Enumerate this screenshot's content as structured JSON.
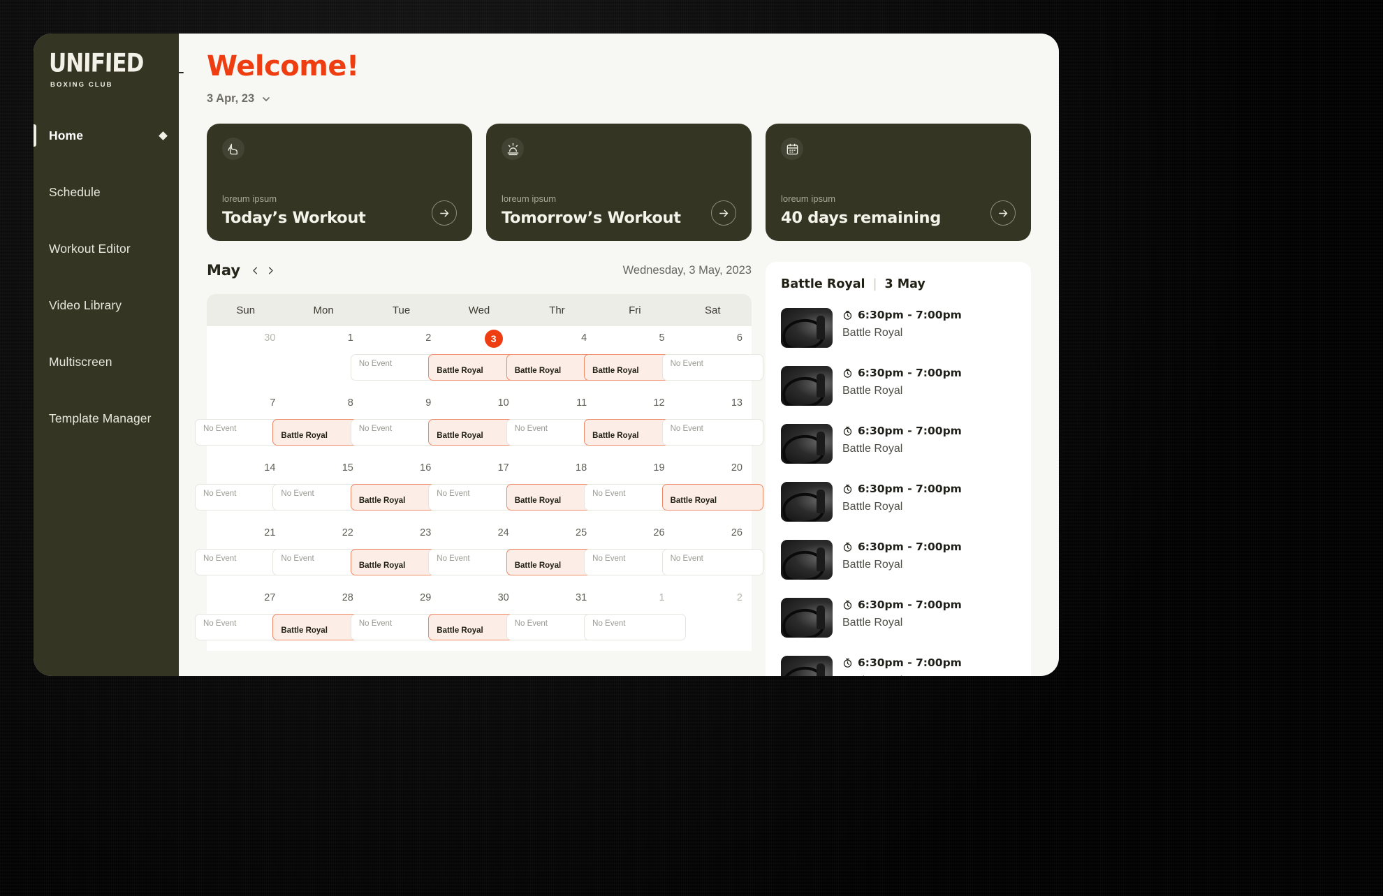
{
  "sidebar": {
    "logo": {
      "main": "UNIFIED",
      "sub": "BOXING CLUB"
    },
    "items": [
      {
        "label": "Home",
        "active": true,
        "icon": "diamond-icon"
      },
      {
        "label": "Schedule",
        "active": false
      },
      {
        "label": "Workout Editor",
        "active": false
      },
      {
        "label": "Video Library",
        "active": false
      },
      {
        "label": "Multiscreen",
        "active": false
      },
      {
        "label": "Template Manager",
        "active": false
      }
    ]
  },
  "header": {
    "back_icon": "arrow-left-icon",
    "title": "Welcome!",
    "date_value": "3 Apr, 23",
    "date_chevron": "chevron-down-icon",
    "title_color": "#EE3E11"
  },
  "cards": [
    {
      "icon": "bicep-icon",
      "subtitle": "loreum ipsum",
      "title": "Today’s Workout",
      "arrow": "arrow-right-icon"
    },
    {
      "icon": "sunrise-icon",
      "subtitle": "loreum ipsum",
      "title": "Tomorrow’s Workout",
      "arrow": "arrow-right-icon"
    },
    {
      "icon": "calendar-icon",
      "subtitle": "loreum ipsum",
      "title": "40 days remaining",
      "arrow": "arrow-right-icon"
    }
  ],
  "calendar": {
    "month": "May",
    "prev_icon": "chevron-left-icon",
    "next_icon": "chevron-right-icon",
    "full_date": "Wednesday, 3 May, 2023",
    "day_headers": [
      "Sun",
      "Mon",
      "Tue",
      "Wed",
      "Thr",
      "Fri",
      "Sat"
    ],
    "event_label": "Battle Royal",
    "empty_label": "No Event",
    "today": 3,
    "weeks": [
      [
        {
          "num": "30",
          "muted": true,
          "pill": null
        },
        {
          "num": "1",
          "muted": false,
          "pill": null
        },
        {
          "num": "2",
          "muted": false,
          "pill": "none"
        },
        {
          "num": "3",
          "muted": false,
          "pill": "event",
          "today": true
        },
        {
          "num": "4",
          "muted": false,
          "pill": "event"
        },
        {
          "num": "5",
          "muted": false,
          "pill": "event"
        },
        {
          "num": "6",
          "muted": false,
          "pill": "none"
        }
      ],
      [
        {
          "num": "7",
          "muted": false,
          "pill": "none"
        },
        {
          "num": "8",
          "muted": false,
          "pill": "event"
        },
        {
          "num": "9",
          "muted": false,
          "pill": "none"
        },
        {
          "num": "10",
          "muted": false,
          "pill": "event"
        },
        {
          "num": "11",
          "muted": false,
          "pill": "none"
        },
        {
          "num": "12",
          "muted": false,
          "pill": "event"
        },
        {
          "num": "13",
          "muted": false,
          "pill": "none"
        }
      ],
      [
        {
          "num": "14",
          "muted": false,
          "pill": "none"
        },
        {
          "num": "15",
          "muted": false,
          "pill": "none"
        },
        {
          "num": "16",
          "muted": false,
          "pill": "event"
        },
        {
          "num": "17",
          "muted": false,
          "pill": "none"
        },
        {
          "num": "18",
          "muted": false,
          "pill": "event"
        },
        {
          "num": "19",
          "muted": false,
          "pill": "none"
        },
        {
          "num": "20",
          "muted": false,
          "pill": "event"
        }
      ],
      [
        {
          "num": "21",
          "muted": false,
          "pill": "none"
        },
        {
          "num": "22",
          "muted": false,
          "pill": "none"
        },
        {
          "num": "23",
          "muted": false,
          "pill": "event"
        },
        {
          "num": "24",
          "muted": false,
          "pill": "none"
        },
        {
          "num": "25",
          "muted": false,
          "pill": "event"
        },
        {
          "num": "26",
          "muted": false,
          "pill": "none"
        },
        {
          "num": "26",
          "muted": false,
          "pill": "none"
        }
      ],
      [
        {
          "num": "27",
          "muted": false,
          "pill": "none"
        },
        {
          "num": "28",
          "muted": false,
          "pill": "event"
        },
        {
          "num": "29",
          "muted": false,
          "pill": "none"
        },
        {
          "num": "30",
          "muted": false,
          "pill": "event"
        },
        {
          "num": "31",
          "muted": false,
          "pill": "none"
        },
        {
          "num": "1",
          "muted": true,
          "pill": "none"
        },
        {
          "num": "2",
          "muted": true,
          "pill": null
        }
      ]
    ]
  },
  "event_panel": {
    "title": "Battle Royal",
    "separator": "|",
    "date": "3 May",
    "clock_icon": "clock-icon",
    "events": [
      {
        "time": "6:30pm - 7:00pm",
        "name": "Battle Royal"
      },
      {
        "time": "6:30pm - 7:00pm",
        "name": "Battle Royal"
      },
      {
        "time": "6:30pm - 7:00pm",
        "name": "Battle Royal"
      },
      {
        "time": "6:30pm - 7:00pm",
        "name": "Battle Royal"
      },
      {
        "time": "6:30pm - 7:00pm",
        "name": "Battle Royal"
      },
      {
        "time": "6:30pm - 7:00pm",
        "name": "Battle Royal"
      },
      {
        "time": "6:30pm - 7:00pm",
        "name": "Battle Royal"
      }
    ]
  },
  "colors": {
    "accent": "#EE3E11",
    "dark": "#343523",
    "page_bg": "#F7F7F4",
    "event_bg": "#FDEDE7",
    "event_border": "#EE8A66"
  }
}
